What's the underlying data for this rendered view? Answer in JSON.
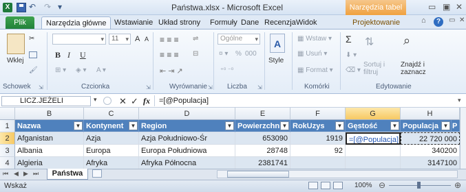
{
  "title": "Państwa.xlsx - Microsoft Excel",
  "context_tab_group": "Narzędzia tabel",
  "window_controls": {
    "minimize": "▭",
    "maximize": "▣",
    "close": "✕"
  },
  "qat": {
    "app": "X",
    "undo": "↶",
    "redo": "↷",
    "more": "▾"
  },
  "tabs": {
    "file": "Plik",
    "home": "Narzędzia główne",
    "insert": "Wstawianie",
    "layout": "Układ strony",
    "formulas": "Formuły",
    "data": "Dane",
    "review": "Recenzja",
    "view": "Widok",
    "design": "Projektowanie"
  },
  "ribbon": {
    "clipboard": {
      "label": "Schowek",
      "paste": "Wklej"
    },
    "font": {
      "label": "Czcionka",
      "size": "11",
      "bold": "B",
      "italic": "I",
      "underline": "U",
      "grow": "A",
      "shrink": "A"
    },
    "alignment": {
      "label": "Wyrównanie"
    },
    "number": {
      "label": "Liczba",
      "format": "Ogólne",
      "percent": "%",
      "thousands": "000"
    },
    "styles": {
      "label": "Style",
      "button": "Style"
    },
    "cells": {
      "label": "Komórki",
      "insert": "Wstaw",
      "delete": "Usuń",
      "format": "Format"
    },
    "editing": {
      "label": "Edytowanie",
      "sum": "Σ",
      "sort": "Sortuj i filtruj",
      "find": "Znajdź i zaznacz"
    }
  },
  "formula_bar": {
    "name_box": "LICZ.JEŻELI",
    "cancel": "✕",
    "enter": "✓",
    "fx": "fx",
    "formula": "=[@Populacja]"
  },
  "columns": [
    "B",
    "C",
    "D",
    "E",
    "F",
    "G",
    "H"
  ],
  "table_headers": [
    "Nazwa",
    "Kontynent",
    "Region",
    "Powierzchnia",
    "RokUzys",
    "Gęstość",
    "Populacja",
    "P"
  ],
  "rows": [
    {
      "num": "1"
    },
    {
      "num": "2",
      "cells": [
        "Afganistan",
        "Azja",
        "Azja Południowo-Śr",
        "653090",
        "1919",
        "=[@Populacja]",
        "22 720 000"
      ]
    },
    {
      "num": "3",
      "cells": [
        "Albania",
        "Europa",
        "Europa Południowa",
        "28748",
        "92",
        "",
        "340200"
      ]
    },
    {
      "num": "4",
      "cells": [
        "Algieria",
        "Afryka",
        "Afryka Północna",
        "2381741",
        "",
        "",
        "3147100"
      ]
    }
  ],
  "sheet_tab": "Państwa",
  "status": "Wskaż",
  "zoom": "100%"
}
